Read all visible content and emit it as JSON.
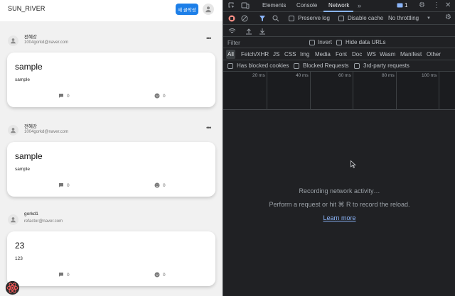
{
  "app": {
    "brand": "SUN_RIVER",
    "new_post_label": "새 글작성",
    "posts": [
      {
        "author_name": "전혜강",
        "author_email": "1004gorkd@naver.com",
        "title": "sample",
        "body": "sample",
        "comments": "0",
        "likes": "0"
      },
      {
        "author_name": "전혜강",
        "author_email": "1004gorkd@naver.com",
        "title": "sample",
        "body": "sample",
        "comments": "0",
        "likes": "0"
      },
      {
        "author_name": "gorkd1",
        "author_email": "refactor@naver.com",
        "title": "23",
        "body": "123",
        "comments": "0",
        "likes": "0"
      }
    ],
    "colors": {
      "accent": "#1d7fe8",
      "feed_bg": "#f1f1f1"
    }
  },
  "devtools": {
    "tabs": [
      "Elements",
      "Console",
      "Network"
    ],
    "active_tab": "Network",
    "issues_count": "1",
    "toolbar": {
      "preserve_log": "Preserve log",
      "disable_cache": "Disable cache",
      "throttling": "No throttling"
    },
    "filter": {
      "placeholder": "Filter",
      "invert": "Invert",
      "hide_data_urls": "Hide data URLs"
    },
    "types": [
      "All",
      "Fetch/XHR",
      "JS",
      "CSS",
      "Img",
      "Media",
      "Font",
      "Doc",
      "WS",
      "Wasm",
      "Manifest",
      "Other"
    ],
    "blocked": {
      "blocked_cookies": "Has blocked cookies",
      "blocked_requests": "Blocked Requests",
      "third_party": "3rd-party requests"
    },
    "timeline_ticks": [
      "20 ms",
      "40 ms",
      "60 ms",
      "80 ms",
      "100 ms"
    ],
    "empty": {
      "line1": "Recording network activity…",
      "line2": "Perform a request or hit ⌘ R to record the reload.",
      "link": "Learn more"
    },
    "colors": {
      "bg": "#202124",
      "link": "#8ab4f8",
      "record": "#f28b82"
    }
  }
}
